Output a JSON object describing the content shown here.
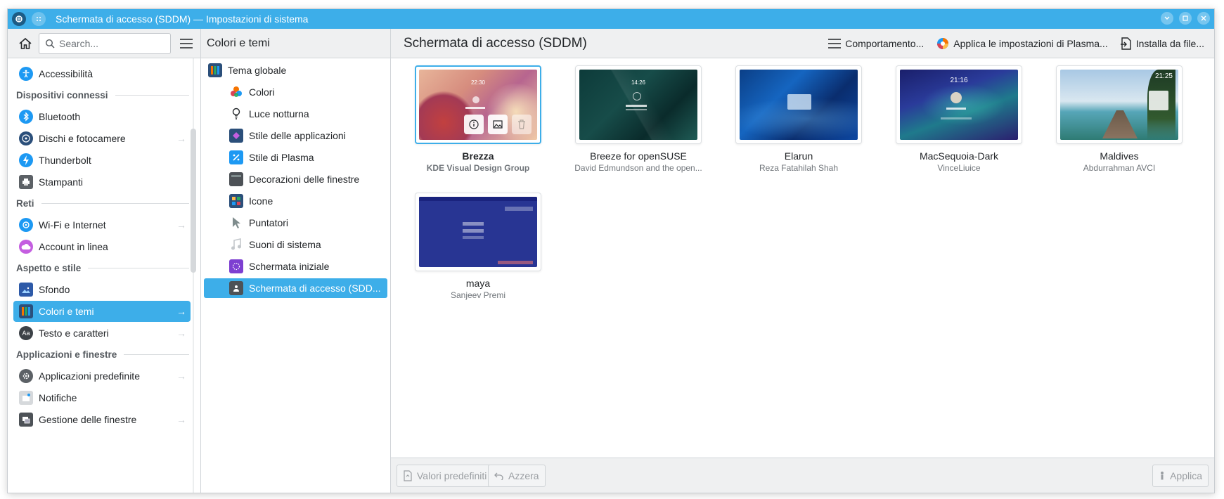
{
  "window": {
    "title": "Schermata di accesso (SDDM) — Impostazioni di sistema",
    "controls": [
      "minimize-icon",
      "maximize-icon",
      "close-icon"
    ]
  },
  "header": {
    "search_placeholder": "Search...",
    "subpanel_title": "Colori e temi",
    "page_title": "Schermata di accesso (SDDM)",
    "toolbar": {
      "behaviour_label": "Comportamento...",
      "apply_plasma_label": "Applica le impostazioni di Plasma...",
      "install_file_label": "Installa da file..."
    }
  },
  "sidebar": {
    "top_item": {
      "label": "Accessibilità",
      "icon": "accessibility-icon"
    },
    "sections": [
      {
        "title": "Dispositivi connessi",
        "items": [
          {
            "label": "Bluetooth",
            "icon": "bluetooth-icon",
            "arrow": false
          },
          {
            "label": "Dischi e fotocamere",
            "icon": "disks-icon",
            "arrow": true
          },
          {
            "label": "Thunderbolt",
            "icon": "thunderbolt-icon",
            "arrow": false
          },
          {
            "label": "Stampanti",
            "icon": "printer-icon",
            "arrow": false
          }
        ]
      },
      {
        "title": "Reti",
        "items": [
          {
            "label": "Wi-Fi e Internet",
            "icon": "network-icon",
            "arrow": true
          },
          {
            "label": "Account in linea",
            "icon": "cloud-icon",
            "arrow": false
          }
        ]
      },
      {
        "title": "Aspetto e stile",
        "items": [
          {
            "label": "Sfondo",
            "icon": "wallpaper-icon",
            "arrow": false
          },
          {
            "label": "Colori e temi",
            "icon": "themes-icon",
            "arrow": true,
            "selected": true
          },
          {
            "label": "Testo e caratteri",
            "icon": "fonts-icon",
            "arrow": true
          }
        ]
      },
      {
        "title": "Applicazioni e finestre",
        "items": [
          {
            "label": "Applicazioni predefinite",
            "icon": "default-apps-icon",
            "arrow": true
          },
          {
            "label": "Notifiche",
            "icon": "notifications-icon",
            "arrow": false
          },
          {
            "label": "Gestione delle finestre",
            "icon": "window-management-icon",
            "arrow": true
          }
        ]
      }
    ]
  },
  "subpanel": {
    "items": [
      {
        "label": "Tema globale",
        "icon": "global-theme-icon",
        "level": 0
      },
      {
        "label": "Colori",
        "icon": "colors-icon",
        "level": 1
      },
      {
        "label": "Luce notturna",
        "icon": "night-light-icon",
        "level": 1
      },
      {
        "label": "Stile delle applicazioni",
        "icon": "app-style-icon",
        "level": 1
      },
      {
        "label": "Stile di Plasma",
        "icon": "plasma-style-icon",
        "level": 1
      },
      {
        "label": "Decorazioni delle finestre",
        "icon": "window-decorations-icon",
        "level": 1
      },
      {
        "label": "Icone",
        "icon": "icons-icon",
        "level": 1
      },
      {
        "label": "Puntatori",
        "icon": "cursor-icon",
        "level": 1
      },
      {
        "label": "Suoni di sistema",
        "icon": "sound-icon",
        "level": 1
      },
      {
        "label": "Schermata iniziale",
        "icon": "splash-icon",
        "level": 1
      },
      {
        "label": "Schermata di accesso (SDD...",
        "icon": "login-screen-icon",
        "level": 1,
        "selected": true
      }
    ]
  },
  "themes": [
    {
      "name": "Brezza",
      "author": "KDE Visual Design Group",
      "selected": true,
      "time": "22:30"
    },
    {
      "name": "Breeze for openSUSE",
      "author": "David Edmundson and the open...",
      "time": "14:26"
    },
    {
      "name": "Elarun",
      "author": "Reza Fatahilah Shah"
    },
    {
      "name": "MacSequoia-Dark",
      "author": "VinceLiuice",
      "time": "21:16"
    },
    {
      "name": "Maldives",
      "author": "Abdurrahman AVCI",
      "time": "21:25"
    },
    {
      "name": "maya",
      "author": "Sanjeev Premi"
    }
  ],
  "footer": {
    "defaults_label": "Valori predefiniti",
    "reset_label": "Azzera",
    "apply_label": "Applica"
  },
  "colors": {
    "accent": "#3daee9",
    "window_bg": "#eff0f1"
  }
}
